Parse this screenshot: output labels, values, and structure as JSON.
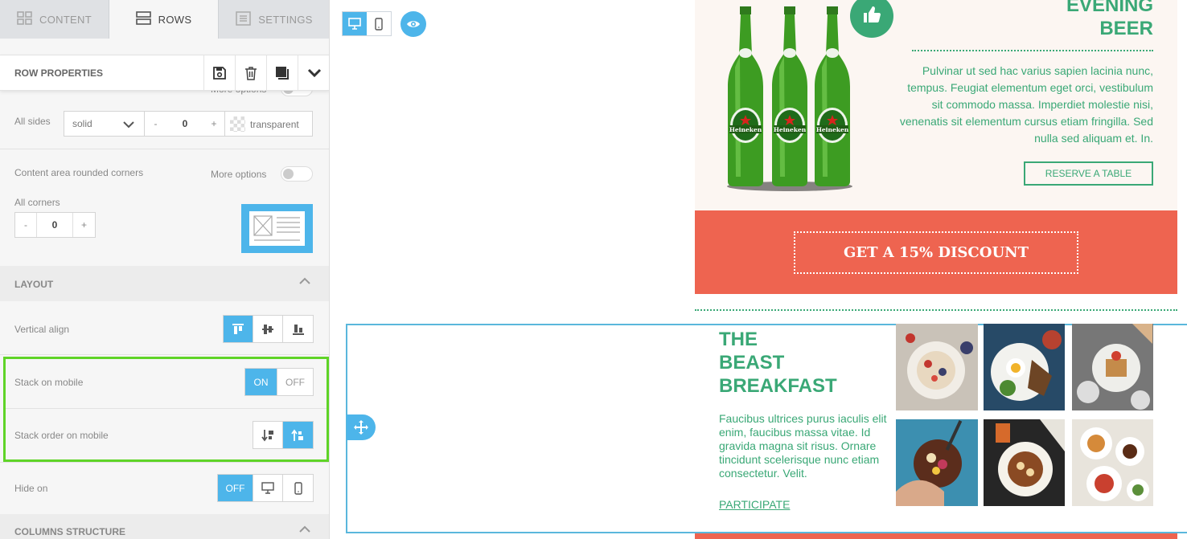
{
  "tabs": [
    {
      "label": "CONTENT",
      "icon": "grid-icon",
      "active": false
    },
    {
      "label": "ROWS",
      "icon": "rows-icon",
      "active": true
    },
    {
      "label": "SETTINGS",
      "icon": "settings-list-icon",
      "active": false
    }
  ],
  "row_properties": {
    "title": "ROW PROPERTIES",
    "actions": [
      "save-icon",
      "trash-icon",
      "duplicate-icon",
      "chevron-down-icon"
    ]
  },
  "border": {
    "more_options_label": "More options",
    "all_sides_label": "All sides",
    "style_value": "solid",
    "width_minus": "-",
    "width_value": "0",
    "width_plus": "+",
    "color_value": "transparent"
  },
  "rounded": {
    "label": "Content area rounded corners",
    "more_options_label": "More options",
    "all_corners_label": "All corners",
    "minus": "-",
    "value": "0",
    "plus": "+"
  },
  "layout": {
    "section_title": "LAYOUT",
    "vertical_align_label": "Vertical align",
    "stack_on_mobile_label": "Stack on mobile",
    "stack_on": "ON",
    "stack_off": "OFF",
    "stack_order_label": "Stack order on mobile",
    "hide_on_label": "Hide on",
    "hide_off": "OFF"
  },
  "columns": {
    "section_title": "COLUMNS STRUCTURE"
  },
  "colors": {
    "accent": "#4db5ea",
    "highlight": "#5fd427",
    "brand_green": "#3aa876",
    "coral": "#ee6450"
  },
  "canvas": {
    "beer": {
      "title_lines": [
        "EVENING",
        "BEER"
      ],
      "paragraph": "Pulvinar ut sed hac varius sapien lacinia nunc, tempus. Feugiat elementum eget orci, vestibulum sit commodo massa. Imperdiet molestie nisi, venenatis sit elementum cursus etiam fringilla. Sed nulla sed aliquam et. In.",
      "button": "RESERVE A TABLE",
      "bottle_label": "Heineken"
    },
    "discount_button": "GET A 15% DISCOUNT",
    "breakfast": {
      "title_lines": [
        "THE",
        "BEAST",
        "BREAKFAST"
      ],
      "paragraph": "Faucibus ultrices purus iaculis elit enim, faucibus massa vitae. Id gravida magna sit risus. Ornare tincidunt scelerisque nunc etiam consectetur. Velit.",
      "link": "PARTICIPATE"
    }
  }
}
